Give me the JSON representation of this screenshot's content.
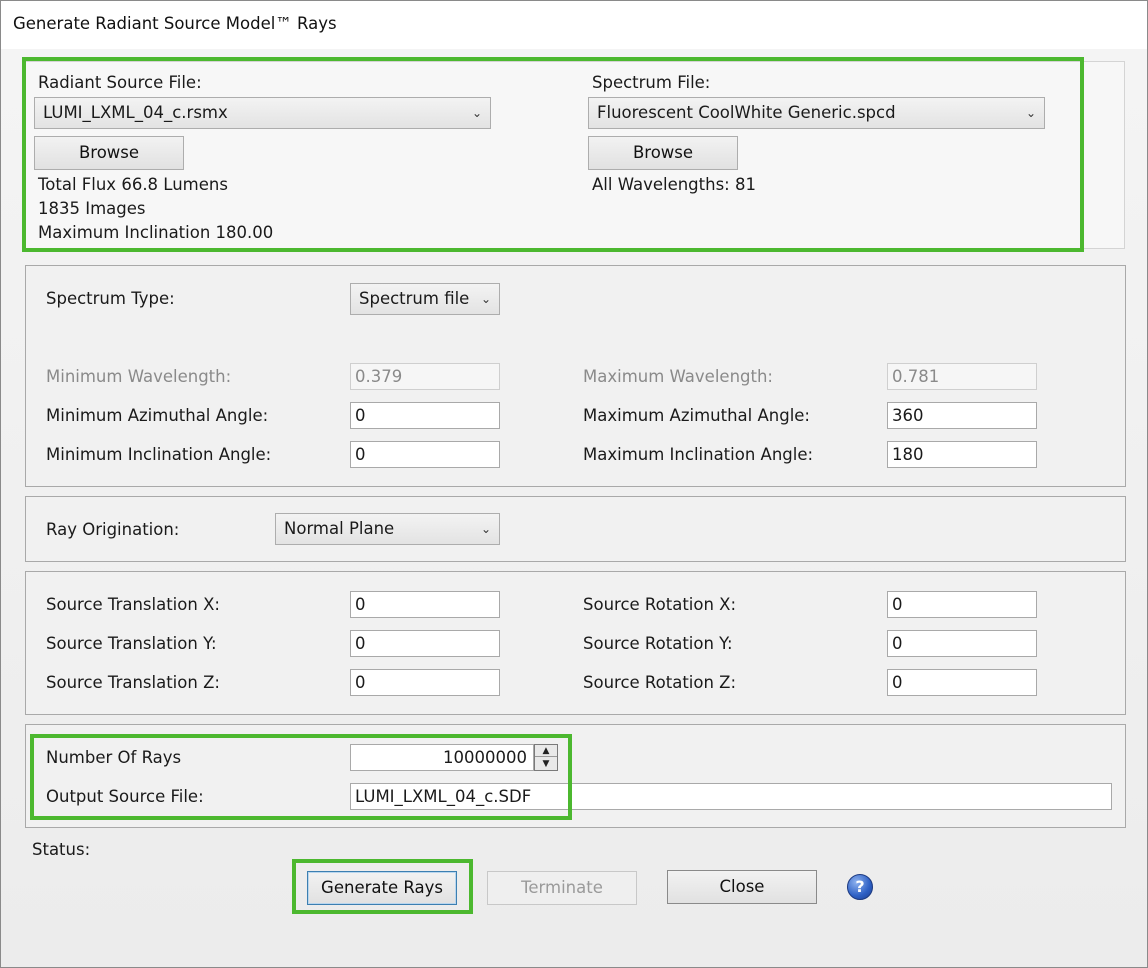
{
  "window": {
    "title": "Generate Radiant Source Model™ Rays"
  },
  "source_section": {
    "radiant_label": "Radiant Source File:",
    "radiant_file": "LUMI_LXML_04_c.rsmx",
    "radiant_browse": "Browse",
    "info": [
      "Total Flux 66.8 Lumens",
      "1835 Images",
      "Maximum Inclination 180.00"
    ],
    "spectrum_label": "Spectrum File:",
    "spectrum_file": "Fluorescent CoolWhite Generic.spcd",
    "spectrum_browse": "Browse",
    "wavelengths": "All Wavelengths: 81"
  },
  "spectrum_section": {
    "type_label": "Spectrum Type:",
    "type_value": "Spectrum file",
    "min_wavelength_label": "Minimum Wavelength:",
    "min_wavelength": "0.379",
    "max_wavelength_label": "Maximum Wavelength:",
    "max_wavelength": "0.781",
    "min_azimuth_label": "Minimum Azimuthal Angle:",
    "min_azimuth": "0",
    "max_azimuth_label": "Maximum Azimuthal Angle:",
    "max_azimuth": "360",
    "min_incl_label": "Minimum Inclination Angle:",
    "min_incl": "0",
    "max_incl_label": "Maximum Inclination Angle:",
    "max_incl": "180"
  },
  "ray_origination": {
    "label": "Ray Origination:",
    "value": "Normal Plane"
  },
  "transform_section": {
    "tx_label": "Source Translation X:",
    "tx": "0",
    "ty_label": "Source Translation Y:",
    "ty": "0",
    "tz_label": "Source Translation Z:",
    "tz": "0",
    "rx_label": "Source Rotation X:",
    "rx": "0",
    "ry_label": "Source Rotation Y:",
    "ry": "0",
    "rz_label": "Source Rotation Z:",
    "rz": "0"
  },
  "output_section": {
    "rays_label": "Number Of Rays",
    "rays": "10000000",
    "output_label": "Output Source File:",
    "output_file": "LUMI_LXML_04_c.SDF"
  },
  "footer": {
    "status_label": "Status:",
    "generate": "Generate Rays",
    "terminate": "Terminate",
    "close": "Close",
    "help_glyph": "?"
  },
  "colors": {
    "highlight": "#4cb82f",
    "default_button_border": "#3c7fb1"
  },
  "icons": {
    "dropdown": "chevron-down-icon",
    "spin_up": "spin-up-icon",
    "spin_down": "spin-down-icon",
    "help": "help-icon"
  }
}
